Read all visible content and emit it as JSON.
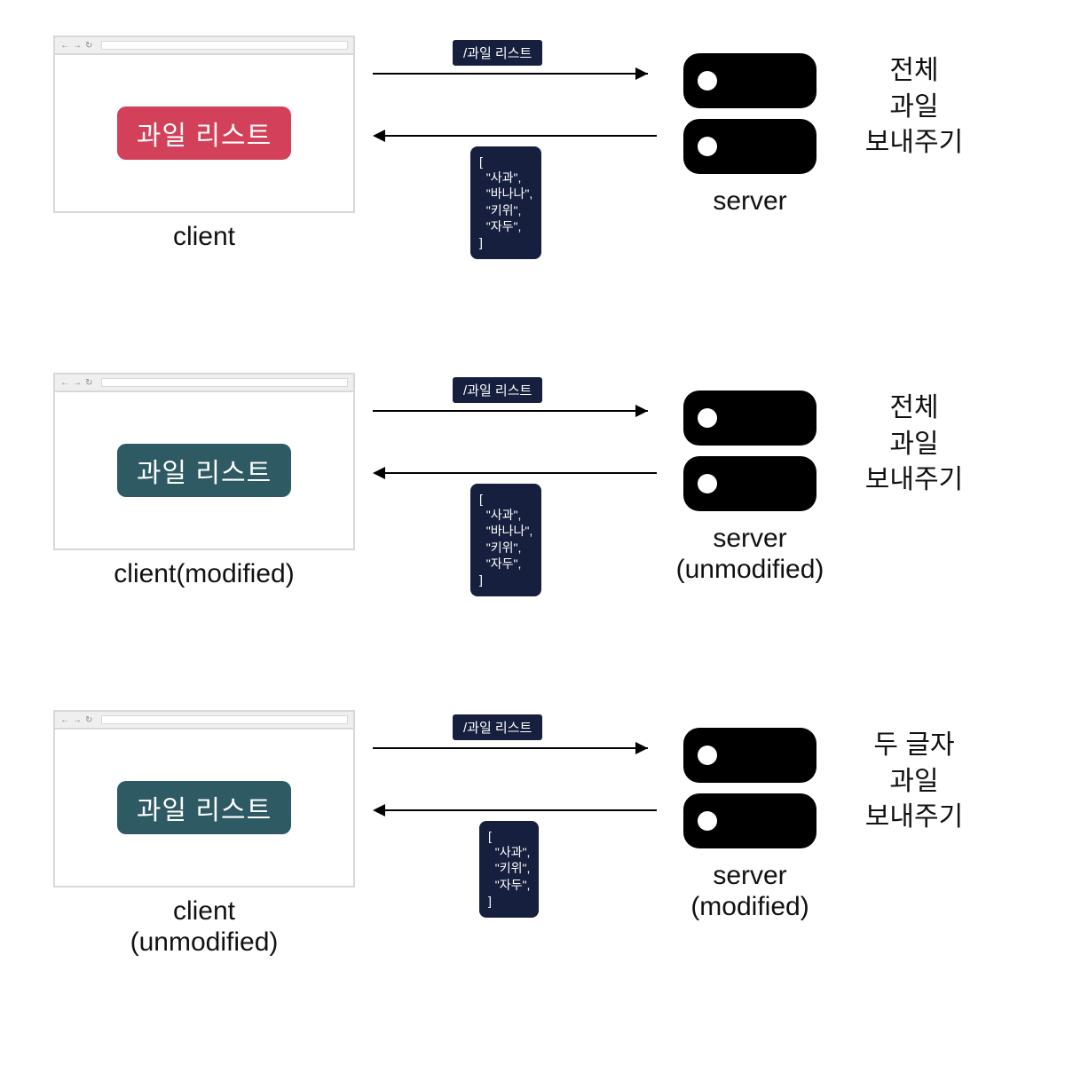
{
  "rows": [
    {
      "client_button": "과일 리스트",
      "button_color": "red",
      "client_label": "client",
      "request_path": "/과일 리스트",
      "response_json": "[\n  \"사과\",\n  \"바나나\",\n  \"키위\",\n  \"자두\",\n]",
      "server_label": "server",
      "server_action": "전체\n과일\n보내주기"
    },
    {
      "client_button": "과일 리스트",
      "button_color": "teal",
      "client_label": "client(modified)",
      "request_path": "/과일 리스트",
      "response_json": "[\n  \"사과\",\n  \"바나나\",\n  \"키위\",\n  \"자두\",\n]",
      "server_label": "server\n(unmodified)",
      "server_action": "전체\n과일\n보내주기"
    },
    {
      "client_button": "과일 리스트",
      "button_color": "teal",
      "client_label": "client\n(unmodified)",
      "request_path": "/과일 리스트",
      "response_json": "[\n  \"사과\",\n  \"키위\",\n  \"자두\",\n]",
      "server_label": "server\n(modified)",
      "server_action": "두 글자\n과일\n보내주기"
    }
  ]
}
